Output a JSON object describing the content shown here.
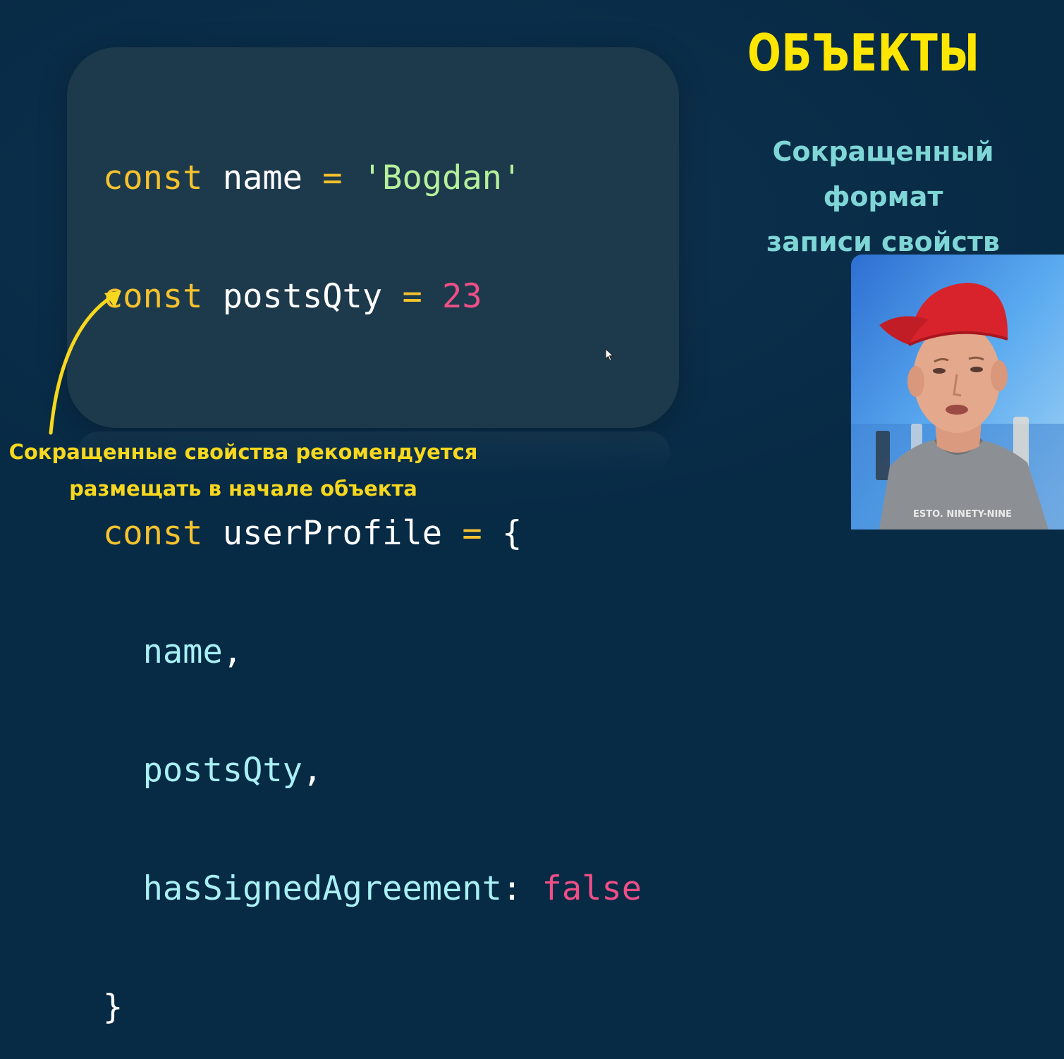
{
  "title": "ОБЪЕКТЫ",
  "subtitle": {
    "line1": "Сокращенный формат",
    "line2": "записи свойств"
  },
  "code": {
    "line1": {
      "kw": "const",
      "id": "name",
      "op": "=",
      "value": "'Bogdan'"
    },
    "line2": {
      "kw": "const",
      "id": "postsQty",
      "op": "=",
      "value": "23"
    },
    "line3": {
      "kw": "const",
      "id": "userProfile",
      "op": "=",
      "brace": "{"
    },
    "line4": {
      "prop": "name",
      "punct": ","
    },
    "line5": {
      "prop": "postsQty",
      "punct": ","
    },
    "line6": {
      "prop": "hasSignedAgreement",
      "punct": ":",
      "value": "false"
    },
    "line7": {
      "brace": "}"
    }
  },
  "note": {
    "line1": "Сокращенные свойства рекомендуется",
    "line2": "размещать в начале объекта"
  },
  "webcam": {
    "shirt_text": "ESTO. NINETY-NINE"
  },
  "colors": {
    "background": "#072a45",
    "code_card": "#1d3a4c",
    "keyword": "#f6c22d",
    "string": "#b6f09c",
    "number": "#ef4f86",
    "property": "#a8f0f4",
    "title": "#ffe600",
    "subtitle": "#7fd6d6",
    "note": "#f7d81e"
  },
  "icons": {
    "arrow": "curved-arrow-icon",
    "cursor": "mouse-cursor-icon"
  }
}
